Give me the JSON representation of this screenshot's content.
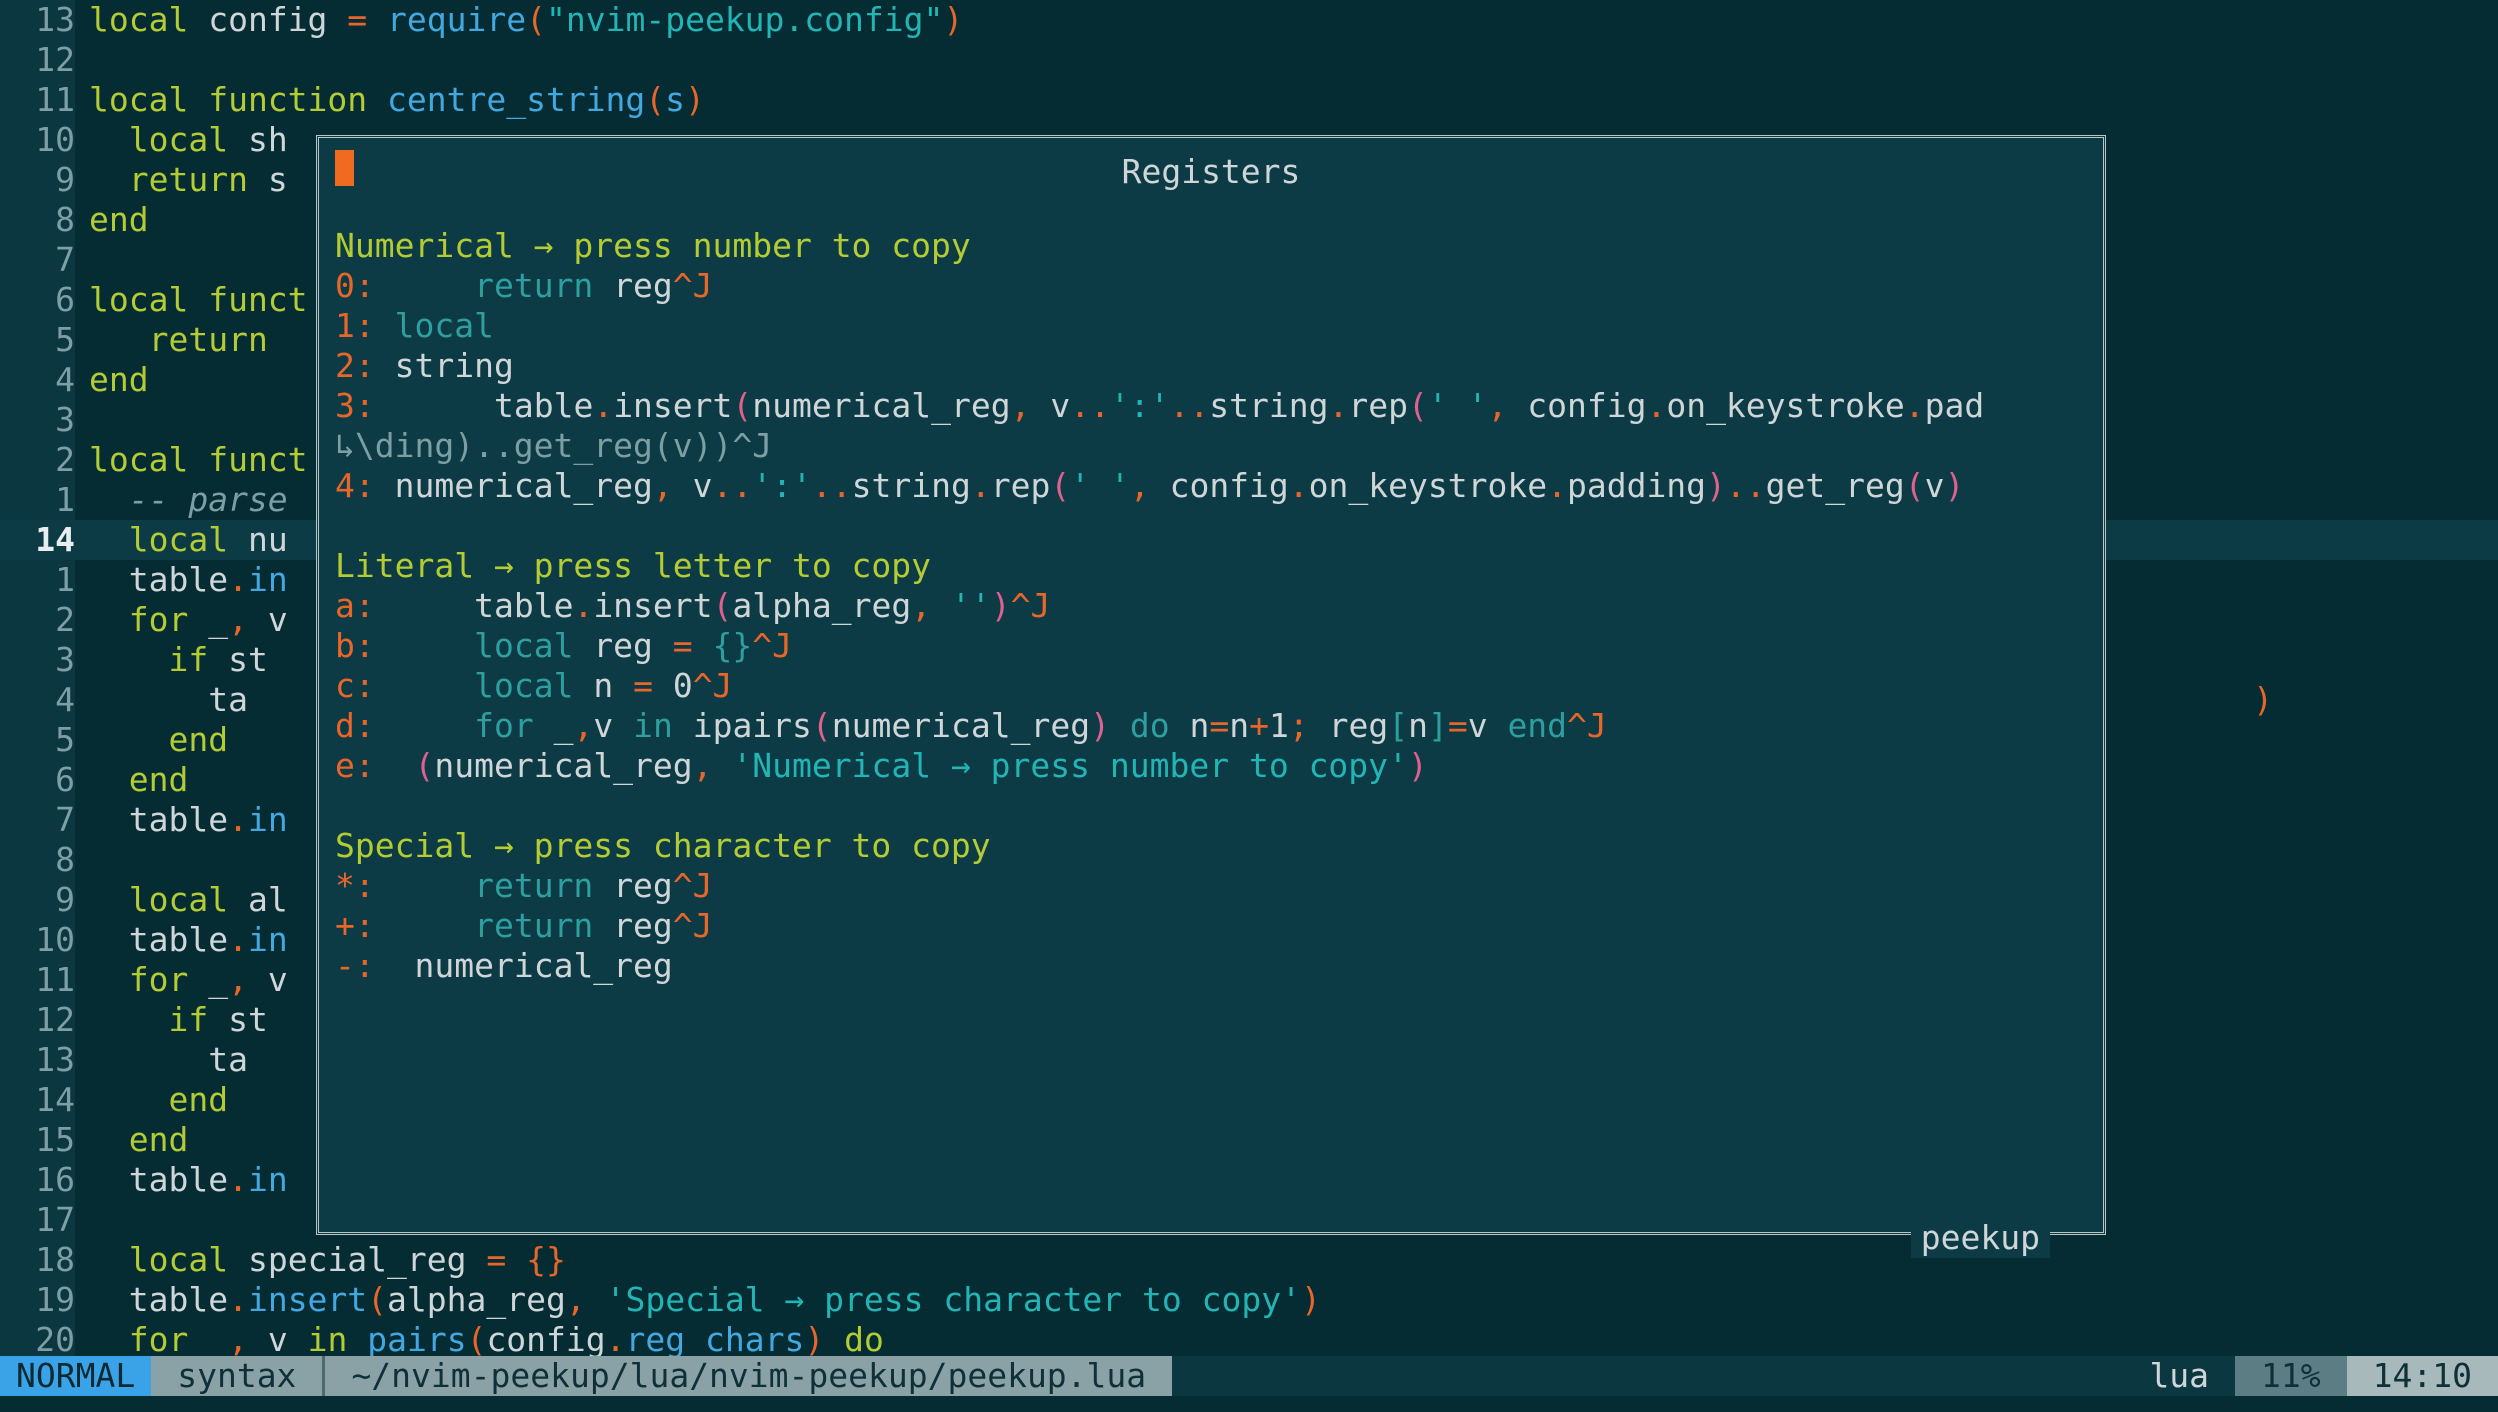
{
  "editor": {
    "name": "neovim",
    "colors": {
      "background": "#062c33",
      "gutter": "#0b3740",
      "float_background": "#0d3b45",
      "cursor": "#f06a22",
      "keyword": "#b3cc33",
      "function": "#44a8e0",
      "string": "#23b5b5",
      "punctuation": "#e8662a",
      "comment": "#7d9fa4",
      "mode_accent": "#3aa3e8"
    },
    "lines": [
      {
        "num": "13",
        "segments": [
          {
            "t": "local ",
            "c": "kw"
          },
          {
            "t": "config ",
            "c": "id"
          },
          {
            "t": "= ",
            "c": "pun"
          },
          {
            "t": "require",
            "c": "fn"
          },
          {
            "t": "(",
            "c": "pun"
          },
          {
            "t": "\"nvim-peekup.config\"",
            "c": "str"
          },
          {
            "t": ")",
            "c": "pun"
          }
        ]
      },
      {
        "num": "12",
        "segments": []
      },
      {
        "num": "11",
        "segments": [
          {
            "t": "local function ",
            "c": "kw"
          },
          {
            "t": "centre_string",
            "c": "fn"
          },
          {
            "t": "(",
            "c": "pun"
          },
          {
            "t": "s",
            "c": "fn"
          },
          {
            "t": ")",
            "c": "pun"
          }
        ]
      },
      {
        "num": "10",
        "segments": [
          {
            "t": "  ",
            "c": "id"
          },
          {
            "t": "local ",
            "c": "kw"
          },
          {
            "t": "sh",
            "c": "id"
          }
        ]
      },
      {
        "num": "9",
        "segments": [
          {
            "t": "  ",
            "c": "id"
          },
          {
            "t": "return ",
            "c": "kw"
          },
          {
            "t": "s",
            "c": "id"
          }
        ]
      },
      {
        "num": "8",
        "segments": [
          {
            "t": "end",
            "c": "kw"
          }
        ]
      },
      {
        "num": "7",
        "segments": []
      },
      {
        "num": "6",
        "segments": [
          {
            "t": "local funct",
            "c": "kw"
          }
        ]
      },
      {
        "num": "5",
        "segments": [
          {
            "t": "   return",
            "c": "kw"
          }
        ]
      },
      {
        "num": "4",
        "segments": [
          {
            "t": "end",
            "c": "kw"
          }
        ]
      },
      {
        "num": "3",
        "segments": []
      },
      {
        "num": "2",
        "segments": [
          {
            "t": "local funct",
            "c": "kw"
          }
        ]
      },
      {
        "num": "1",
        "segments": [
          {
            "t": "  -- parse",
            "c": "cmt"
          }
        ]
      },
      {
        "num": "14",
        "cursorline": true,
        "segments": [
          {
            "t": "  ",
            "c": "id"
          },
          {
            "t": "local ",
            "c": "kw"
          },
          {
            "t": "nu",
            "c": "id"
          }
        ]
      },
      {
        "num": "1",
        "segments": [
          {
            "t": "  table",
            "c": "id"
          },
          {
            "t": ".",
            "c": "dot"
          },
          {
            "t": "in",
            "c": "fn"
          }
        ]
      },
      {
        "num": "2",
        "segments": [
          {
            "t": "  ",
            "c": "id"
          },
          {
            "t": "for ",
            "c": "kw"
          },
          {
            "t": "_",
            "c": "id"
          },
          {
            "t": ", ",
            "c": "pun"
          },
          {
            "t": "v",
            "c": "id"
          }
        ]
      },
      {
        "num": "3",
        "segments": [
          {
            "t": "    ",
            "c": "id"
          },
          {
            "t": "if ",
            "c": "kw"
          },
          {
            "t": "st",
            "c": "id"
          }
        ]
      },
      {
        "num": "4",
        "segments": [
          {
            "t": "      ta",
            "c": "id"
          }
        ],
        "tail": ")",
        "tail_class": "pun"
      },
      {
        "num": "5",
        "segments": [
          {
            "t": "    ",
            "c": "id"
          },
          {
            "t": "end",
            "c": "kw"
          }
        ]
      },
      {
        "num": "6",
        "segments": [
          {
            "t": "  ",
            "c": "id"
          },
          {
            "t": "end",
            "c": "kw"
          }
        ]
      },
      {
        "num": "7",
        "segments": [
          {
            "t": "  table",
            "c": "id"
          },
          {
            "t": ".",
            "c": "dot"
          },
          {
            "t": "in",
            "c": "fn"
          }
        ]
      },
      {
        "num": "8",
        "segments": []
      },
      {
        "num": "9",
        "segments": [
          {
            "t": "  ",
            "c": "id"
          },
          {
            "t": "local ",
            "c": "kw"
          },
          {
            "t": "al",
            "c": "id"
          }
        ]
      },
      {
        "num": "10",
        "segments": [
          {
            "t": "  table",
            "c": "id"
          },
          {
            "t": ".",
            "c": "dot"
          },
          {
            "t": "in",
            "c": "fn"
          }
        ]
      },
      {
        "num": "11",
        "segments": [
          {
            "t": "  ",
            "c": "id"
          },
          {
            "t": "for ",
            "c": "kw"
          },
          {
            "t": "_",
            "c": "id"
          },
          {
            "t": ", ",
            "c": "pun"
          },
          {
            "t": "v",
            "c": "id"
          }
        ]
      },
      {
        "num": "12",
        "segments": [
          {
            "t": "    ",
            "c": "id"
          },
          {
            "t": "if ",
            "c": "kw"
          },
          {
            "t": "st",
            "c": "id"
          }
        ]
      },
      {
        "num": "13",
        "segments": [
          {
            "t": "      ta",
            "c": "id"
          }
        ]
      },
      {
        "num": "14",
        "segments": [
          {
            "t": "    ",
            "c": "id"
          },
          {
            "t": "end",
            "c": "kw"
          }
        ]
      },
      {
        "num": "15",
        "segments": [
          {
            "t": "  ",
            "c": "id"
          },
          {
            "t": "end",
            "c": "kw"
          }
        ]
      },
      {
        "num": "16",
        "segments": [
          {
            "t": "  table",
            "c": "id"
          },
          {
            "t": ".",
            "c": "dot"
          },
          {
            "t": "in",
            "c": "fn"
          }
        ]
      },
      {
        "num": "17",
        "segments": []
      },
      {
        "num": "18",
        "segments": [
          {
            "t": "  ",
            "c": "id"
          },
          {
            "t": "local ",
            "c": "kw"
          },
          {
            "t": "special_reg ",
            "c": "id"
          },
          {
            "t": "= ",
            "c": "pun"
          },
          {
            "t": "{}",
            "c": "pun"
          }
        ]
      },
      {
        "num": "19",
        "segments": [
          {
            "t": "  table",
            "c": "id"
          },
          {
            "t": ".",
            "c": "dot"
          },
          {
            "t": "insert",
            "c": "fn"
          },
          {
            "t": "(",
            "c": "pun"
          },
          {
            "t": "alpha_reg",
            "c": "id"
          },
          {
            "t": ", ",
            "c": "pun"
          },
          {
            "t": "'Special → press character to copy'",
            "c": "str"
          },
          {
            "t": ")",
            "c": "pun"
          }
        ]
      },
      {
        "num": "20",
        "segments": [
          {
            "t": "  ",
            "c": "id"
          },
          {
            "t": "for ",
            "c": "kw"
          },
          {
            "t": "_",
            "c": "id"
          },
          {
            "t": ", ",
            "c": "pun"
          },
          {
            "t": "v ",
            "c": "id"
          },
          {
            "t": "in ",
            "c": "kw"
          },
          {
            "t": "pairs",
            "c": "fn"
          },
          {
            "t": "(",
            "c": "pun"
          },
          {
            "t": "config",
            "c": "id"
          },
          {
            "t": ".",
            "c": "dot"
          },
          {
            "t": "reg_chars",
            "c": "fn"
          },
          {
            "t": ") ",
            "c": "pun"
          },
          {
            "t": "do",
            "c": "kw"
          }
        ]
      }
    ]
  },
  "float_window": {
    "title": "Registers",
    "footer": "peekup",
    "cursor_visible": true,
    "sections": [
      {
        "heading": "Numerical → press number to copy",
        "rows": [
          {
            "key": "0:",
            "value": "     return reg^J"
          },
          {
            "key": "1:",
            "value": " local"
          },
          {
            "key": "2:",
            "value": " string"
          },
          {
            "key": "3:",
            "value": "      table.insert(numerical_reg, v..':'..string.rep(' ', config.on_keystroke.pad"
          },
          {
            "key": "",
            "value": "↳\\ding)..get_reg(v))^J",
            "wrapped": true
          },
          {
            "key": "4:",
            "value": " numerical_reg, v..':'..string.rep(' ', config.on_keystroke.padding)..get_reg(v)"
          }
        ]
      },
      {
        "heading": "Literal → press letter to copy",
        "rows": [
          {
            "key": "a:",
            "value": "     table.insert(alpha_reg, '')^J"
          },
          {
            "key": "b:",
            "value": "     local reg = {}^J"
          },
          {
            "key": "c:",
            "value": "     local n = 0^J"
          },
          {
            "key": "d:",
            "value": "     for _,v in ipairs(numerical_reg) do n=n+1; reg[n]=v end^J"
          },
          {
            "key": "e:",
            "value": "  (numerical_reg, 'Numerical → press number to copy')"
          }
        ]
      },
      {
        "heading": "Special → press character to copy",
        "rows": [
          {
            "key": "*:",
            "value": "     return reg^J"
          },
          {
            "key": "+:",
            "value": "     return reg^J"
          },
          {
            "key": "-:",
            "value": "  numerical_reg"
          }
        ]
      }
    ]
  },
  "statusline": {
    "mode": "NORMAL",
    "segment_syntax": "syntax",
    "file_path": "~/nvim-peekup/lua/nvim-peekup/peekup.lua",
    "filetype": "lua",
    "percent": "11%",
    "time": "14:10"
  }
}
